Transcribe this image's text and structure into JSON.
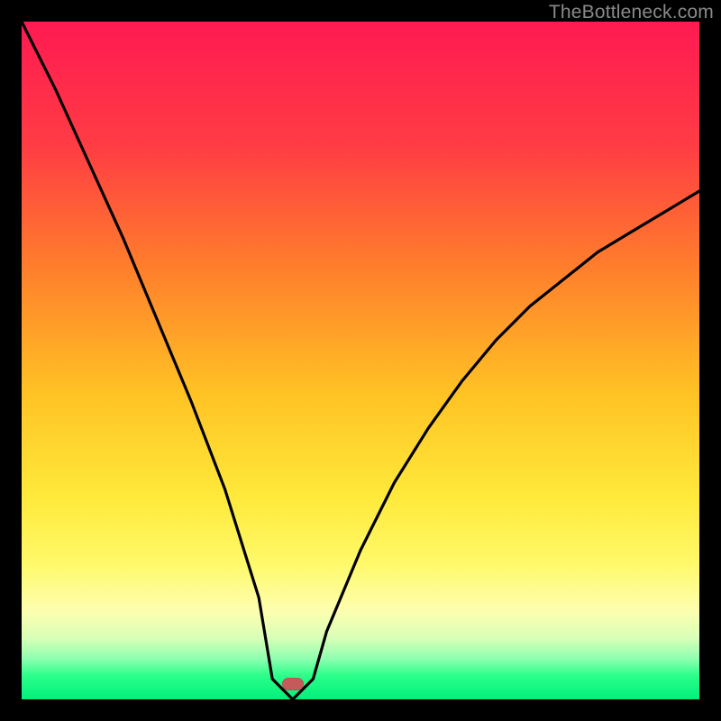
{
  "watermark": "TheBottleneck.com",
  "marker": {
    "color": "#c55a5a"
  },
  "chart_data": {
    "type": "line",
    "title": "",
    "xlabel": "",
    "ylabel": "",
    "xlim": [
      0,
      100
    ],
    "ylim": [
      0,
      100
    ],
    "grid": false,
    "legend": false,
    "minimum_at_x": 40,
    "series": [
      {
        "name": "bottleneck-curve",
        "x": [
          0,
          5,
          10,
          15,
          20,
          25,
          30,
          35,
          37,
          40,
          43,
          45,
          50,
          55,
          60,
          65,
          70,
          75,
          80,
          85,
          90,
          95,
          100
        ],
        "y": [
          100,
          90,
          79,
          68,
          56,
          44,
          31,
          15,
          3,
          0,
          3,
          10,
          22,
          32,
          40,
          47,
          53,
          58,
          62,
          66,
          69,
          72,
          75
        ]
      }
    ],
    "marker": {
      "x": 40,
      "y": 0
    }
  }
}
